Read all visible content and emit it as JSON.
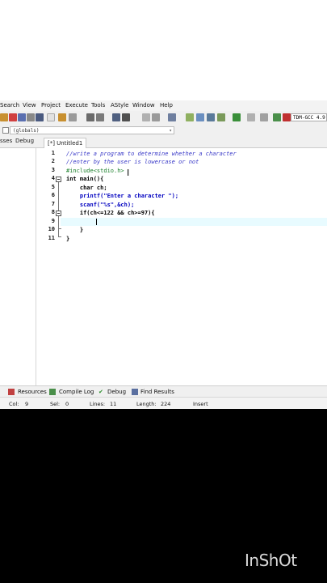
{
  "menu": [
    "Search",
    "View",
    "Project",
    "Execute",
    "Tools",
    "AStyle",
    "Window",
    "Help"
  ],
  "toolbar": {
    "compiler": "TDM-GCC 4.9"
  },
  "scope": {
    "value": "(globals)"
  },
  "left_tabs": [
    "sses",
    "Debug"
  ],
  "file_tab": "[*] Untitled1",
  "editor": {
    "line_numbers": [
      "1",
      "2",
      "3",
      "4",
      "5",
      "6",
      "7",
      "8",
      "9",
      "10",
      "11"
    ],
    "lines": [
      "//write a program to determine whether a character",
      "//enter by the user is lowercase or not",
      "#include<stdio.h>",
      "int main(){",
      "    char ch;",
      "    printf(\"Enter a character \");",
      "    scanf(\"%s\",&ch);",
      "    if(ch<=122 && ch>=97){",
      "",
      "    }",
      "}"
    ]
  },
  "bottom_tabs": [
    "Resources",
    "Compile Log",
    "Debug",
    "Find Results"
  ],
  "status": {
    "col_label": "Col:",
    "col": "9",
    "sel_label": "Sel:",
    "sel": "0",
    "lines_label": "Lines:",
    "lines": "11",
    "length_label": "Length:",
    "length": "224",
    "mode": "Insert"
  },
  "watermark": "InShOt",
  "colors": {
    "comment": "#3a3ac8",
    "preprocessor": "#1a7f2a",
    "string": "#0000c0",
    "number": "#7a3ab0",
    "current_line": "#e8fbff"
  }
}
